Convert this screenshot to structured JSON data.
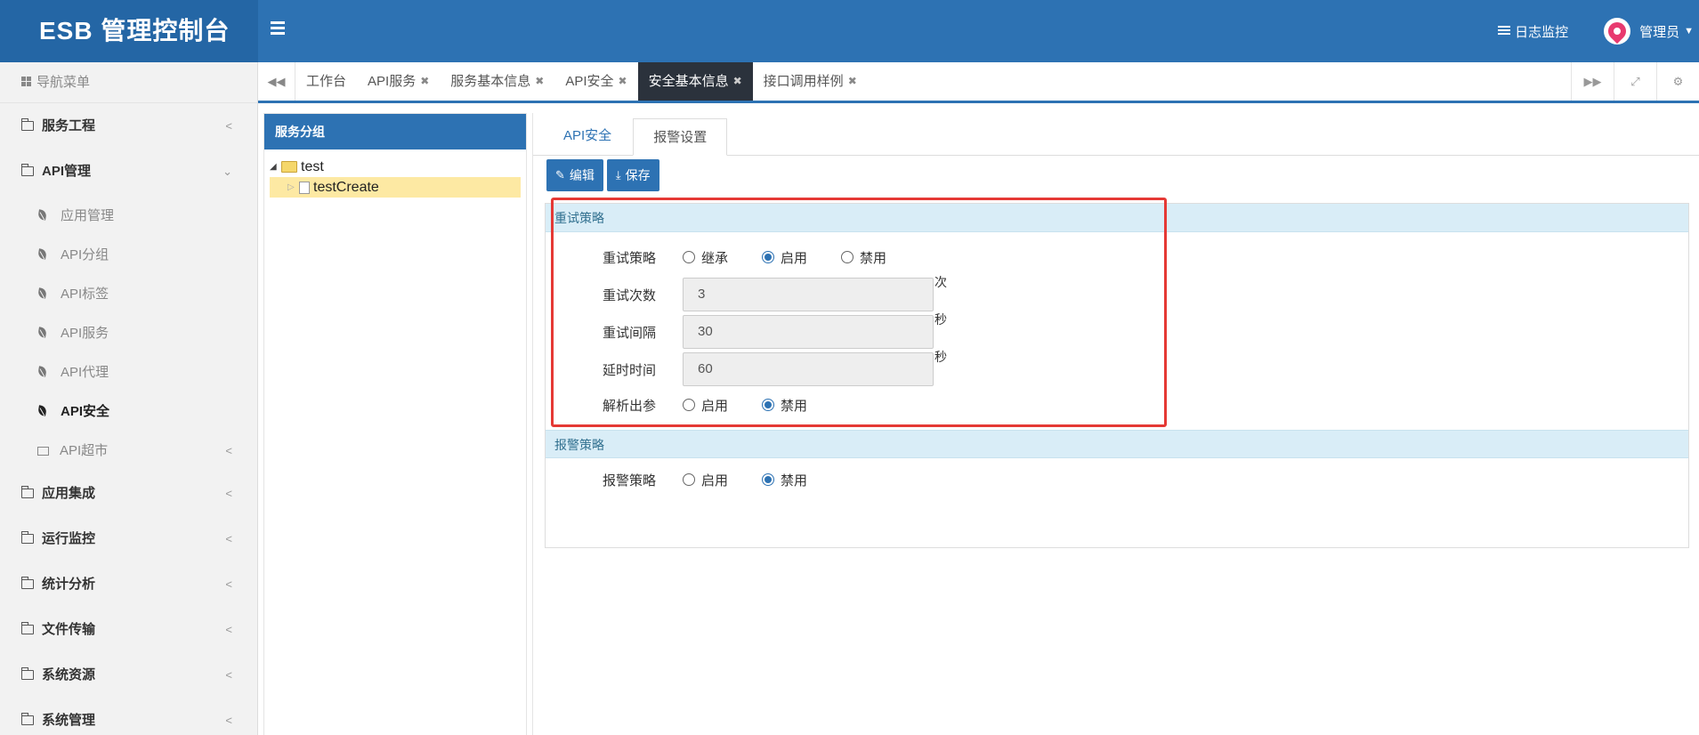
{
  "app": {
    "title": "ESB 管理控制台"
  },
  "header": {
    "log_monitor": "日志监控",
    "user_name": "管理员"
  },
  "sidebar": {
    "nav_title": "导航菜单",
    "items": [
      {
        "label": "服务工程"
      },
      {
        "label": "API管理"
      },
      {
        "label": "应用集成"
      },
      {
        "label": "运行监控"
      },
      {
        "label": "统计分析"
      },
      {
        "label": "文件传输"
      },
      {
        "label": "系统资源"
      },
      {
        "label": "系统管理"
      }
    ],
    "api_sub": [
      {
        "label": "应用管理"
      },
      {
        "label": "API分组"
      },
      {
        "label": "API标签"
      },
      {
        "label": "API服务"
      },
      {
        "label": "API代理"
      },
      {
        "label": "API安全"
      },
      {
        "label": "API超市"
      }
    ]
  },
  "tabs": [
    {
      "label": "工作台"
    },
    {
      "label": "API服务"
    },
    {
      "label": "服务基本信息"
    },
    {
      "label": "API安全"
    },
    {
      "label": "安全基本信息"
    },
    {
      "label": "接口调用样例"
    }
  ],
  "group_panel": {
    "title": "服务分组",
    "tree": [
      {
        "label": "test"
      },
      {
        "label": "testCreate"
      }
    ]
  },
  "content": {
    "tabs": [
      {
        "label": "API安全"
      },
      {
        "label": "报警设置"
      }
    ],
    "edit_button": "编辑",
    "save_button": "保存",
    "retry_section": {
      "title": "重试策略",
      "strategy_label": "重试策略",
      "strategy_options": [
        "继承",
        "启用",
        "禁用"
      ],
      "strategy_selected": "启用",
      "count_label": "重试次数",
      "count_value": "3",
      "count_unit": "次",
      "interval_label": "重试间隔",
      "interval_value": "30",
      "interval_unit": "秒",
      "delay_label": "延时时间",
      "delay_value": "60",
      "delay_unit": "秒",
      "parse_label": "解析出参",
      "parse_options": [
        "启用",
        "禁用"
      ],
      "parse_selected": "禁用"
    },
    "alarm_section": {
      "title": "报警策略",
      "strategy_label": "报警策略",
      "options": [
        "启用",
        "禁用"
      ],
      "selected": "禁用"
    }
  },
  "colors": {
    "header_blue": "#2d72b3",
    "active_tab": "#2b323c",
    "section_bg": "#d9edf7",
    "highlight_red": "#e53935"
  }
}
